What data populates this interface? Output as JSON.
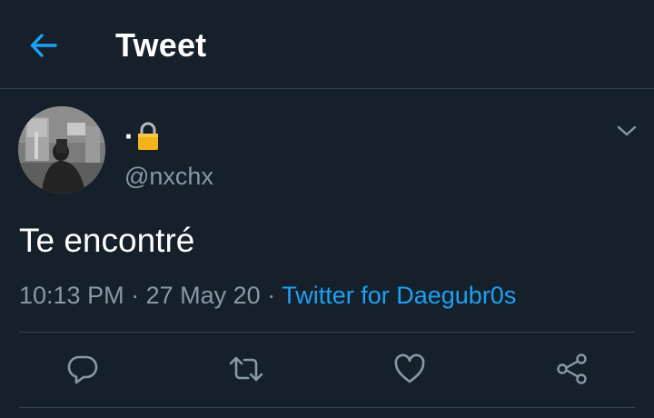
{
  "header": {
    "title": "Tweet",
    "back_icon": "arrow-left-icon"
  },
  "tweet": {
    "author": {
      "display_name": "·",
      "display_name_icon": "lock-icon",
      "handle": "@nxchx",
      "avatar": "avatar-photo"
    },
    "text": "Te encontré",
    "time": "10:13 PM",
    "separator": "·",
    "date": "27 May 20",
    "source": "Twitter for Daegubr0s",
    "menu_icon": "chevron-down-icon"
  },
  "actions": [
    {
      "name": "reply",
      "icon": "reply-icon"
    },
    {
      "name": "retweet",
      "icon": "retweet-icon"
    },
    {
      "name": "like",
      "icon": "heart-icon"
    },
    {
      "name": "share",
      "icon": "share-icon"
    }
  ],
  "colors": {
    "background": "#15202b",
    "accent": "#1da1f2",
    "secondary_text": "#8899a6",
    "divider": "#38444d"
  }
}
